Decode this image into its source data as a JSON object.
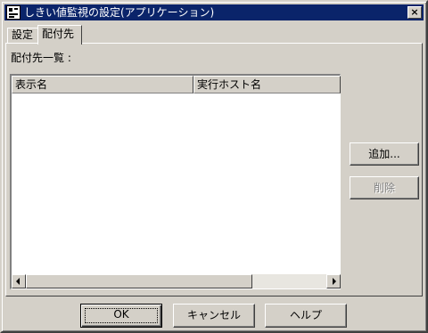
{
  "window": {
    "title": "しきい値監視の設定(アプリケーション)",
    "close_label": "×"
  },
  "tabs": [
    {
      "label": "設定"
    },
    {
      "label": "配付先"
    }
  ],
  "list": {
    "label": "配付先一覧 :",
    "columns": [
      "表示名",
      "実行ホスト名"
    ],
    "rows": []
  },
  "side_buttons": {
    "add_label": "追加...",
    "delete_label": "削除"
  },
  "footer": {
    "ok_label": "OK",
    "cancel_label": "キャンセル",
    "help_label": "ヘルプ"
  }
}
